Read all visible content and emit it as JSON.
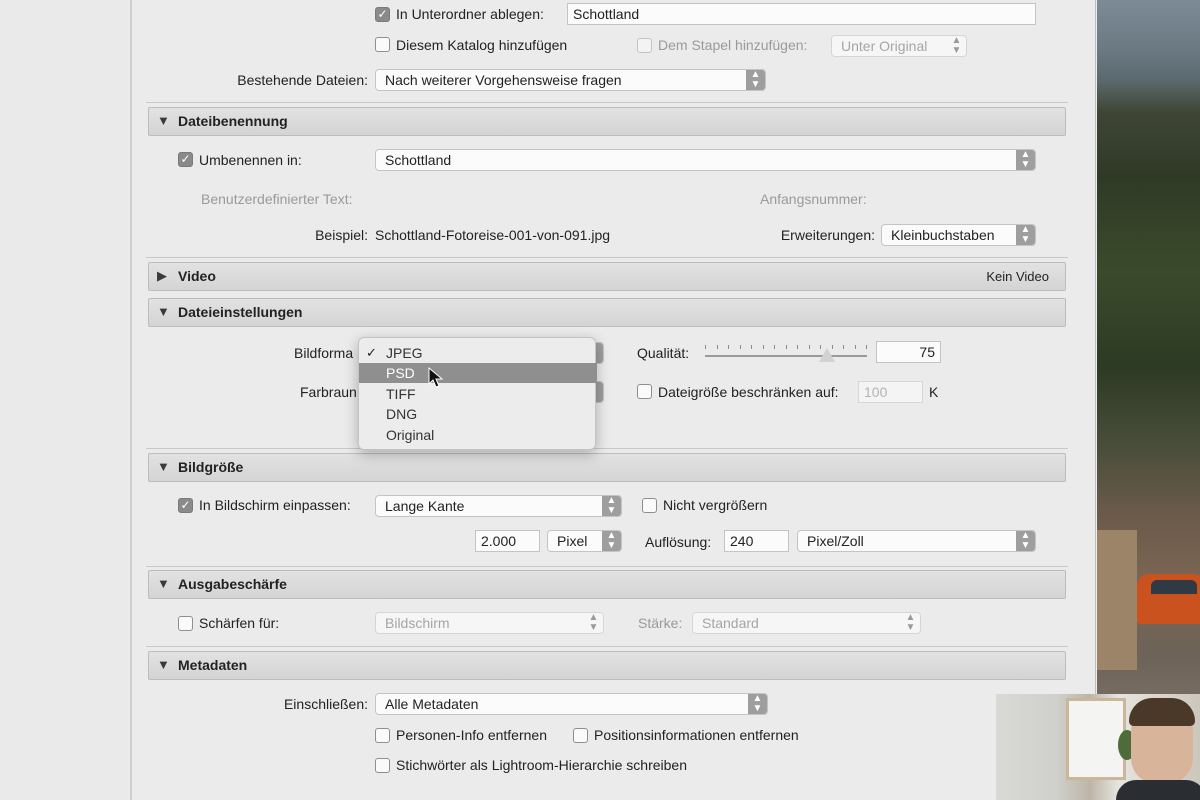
{
  "export_location": {
    "subfolder_checkbox_label": "In Unterordner ablegen:",
    "subfolder_value": "Schottland",
    "add_to_catalog_label": "Diesem Katalog hinzufügen",
    "add_to_stack_label": "Dem Stapel hinzufügen:",
    "stack_position_value": "Unter Original",
    "existing_files_label": "Bestehende Dateien:",
    "existing_files_value": "Nach weiterer Vorgehensweise fragen"
  },
  "file_naming": {
    "title": "Dateibenennung",
    "rename_label": "Umbenennen in:",
    "rename_value": "Schottland",
    "custom_text_label": "Benutzerdefinierter Text:",
    "start_number_label": "Anfangsnummer:",
    "example_label": "Beispiel:",
    "example_value": "Schottland-Fotoreise-001-von-091.jpg",
    "extensions_label": "Erweiterungen:",
    "extensions_value": "Kleinbuchstaben"
  },
  "video": {
    "title": "Video",
    "status": "Kein Video"
  },
  "file_settings": {
    "title": "Dateieinstellungen",
    "image_format_label": "Bildforma",
    "color_space_label": "Farbraun",
    "quality_label": "Qualität:",
    "quality_value": "75",
    "quality_level": 75,
    "limit_size_label": "Dateigröße beschränken auf:",
    "limit_size_value": "100",
    "limit_size_unit": "K",
    "format_options": [
      {
        "label": "JPEG",
        "checked": true
      },
      {
        "label": "PSD",
        "highlighted": true
      },
      {
        "label": "TIFF"
      },
      {
        "label": "DNG"
      },
      {
        "label": "Original"
      }
    ]
  },
  "image_size": {
    "title": "Bildgröße",
    "fit_label": "In Bildschirm einpassen:",
    "fit_value": "Lange Kante",
    "no_enlarge_label": "Nicht vergrößern",
    "size_value": "2.000",
    "size_unit": "Pixel",
    "resolution_label": "Auflösung:",
    "resolution_value": "240",
    "resolution_unit": "Pixel/Zoll"
  },
  "output_sharpening": {
    "title": "Ausgabeschärfe",
    "sharpen_label": "Schärfen für:",
    "sharpen_value": "Bildschirm",
    "amount_label": "Stärke:",
    "amount_value": "Standard"
  },
  "metadata": {
    "title": "Metadaten",
    "include_label": "Einschließen:",
    "include_value": "Alle Metadaten",
    "remove_person_info_label": "Personen-Info entfernen",
    "remove_location_label": "Positionsinformationen entfernen",
    "write_keywords_label": "Stichwörter als Lightroom-Hierarchie schreiben"
  },
  "icons": {
    "expanded": "triangle-down",
    "collapsed": "triangle-right",
    "checkmark": "check",
    "stepper": "up-down-arrows"
  }
}
